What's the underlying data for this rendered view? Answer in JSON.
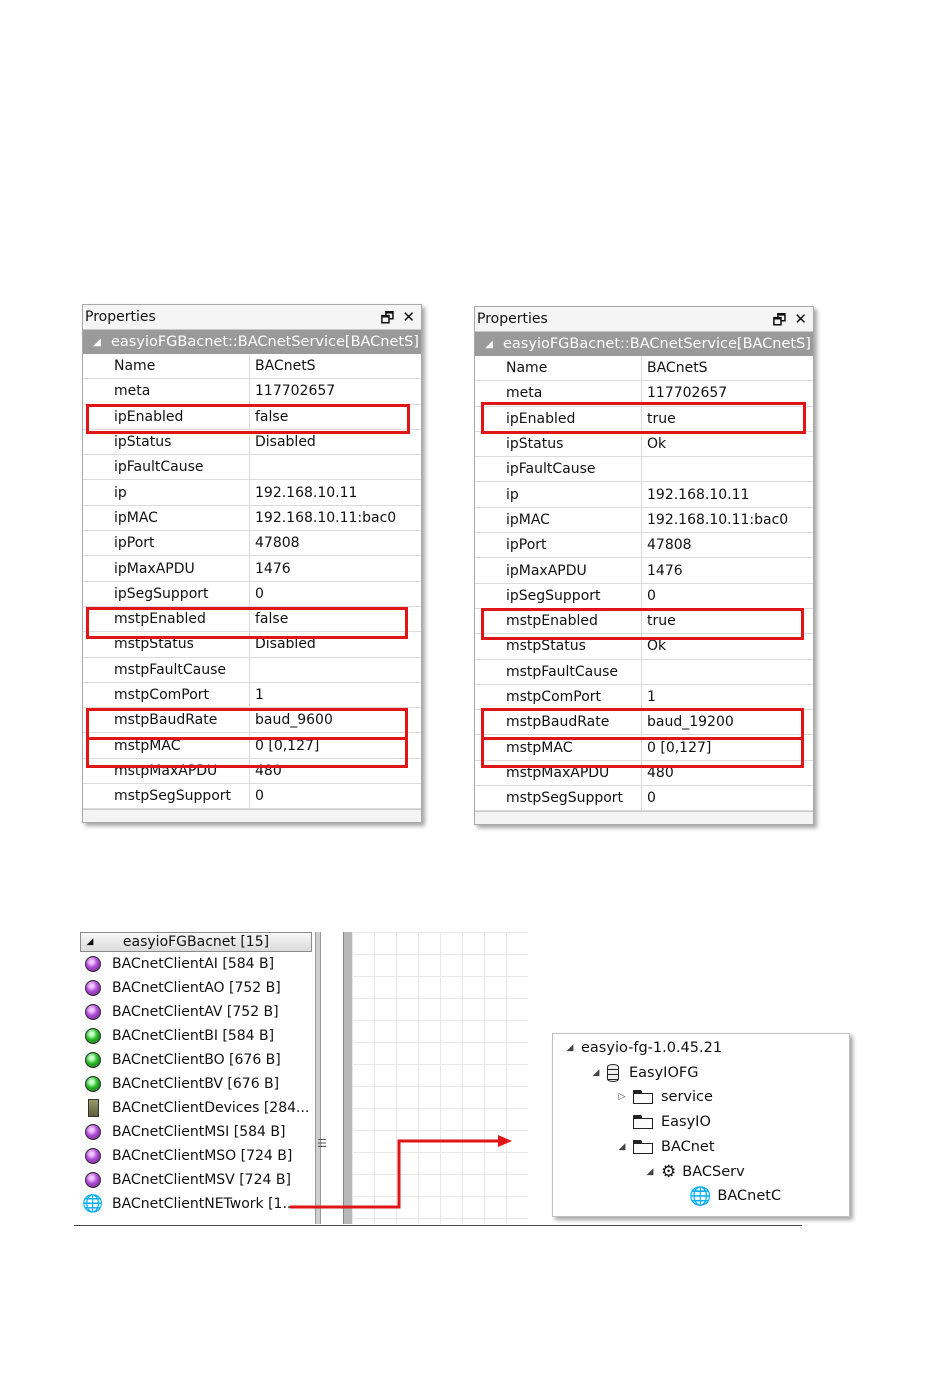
{
  "panel_left": {
    "title": "Properties",
    "object": "easyioFGBacnet::BACnetService[BACnetS]",
    "rows": [
      {
        "k": "Name",
        "v": "BACnetS"
      },
      {
        "k": "meta",
        "v": "117702657"
      },
      {
        "k": "ipEnabled",
        "v": "false"
      },
      {
        "k": "ipStatus",
        "v": "Disabled"
      },
      {
        "k": "ipFaultCause",
        "v": ""
      },
      {
        "k": "ip",
        "v": "192.168.10.11"
      },
      {
        "k": "ipMAC",
        "v": "192.168.10.11:bac0"
      },
      {
        "k": "ipPort",
        "v": "47808"
      },
      {
        "k": "ipMaxAPDU",
        "v": "1476"
      },
      {
        "k": "ipSegSupport",
        "v": "0"
      },
      {
        "k": "mstpEnabled",
        "v": "false"
      },
      {
        "k": "mstpStatus",
        "v": "Disabled"
      },
      {
        "k": "mstpFaultCause",
        "v": ""
      },
      {
        "k": "mstpComPort",
        "v": "1"
      },
      {
        "k": "mstpBaudRate",
        "v": "baud_9600"
      },
      {
        "k": "mstpMAC",
        "v": "0 [0,127]"
      },
      {
        "k": "mstpMaxAPDU",
        "v": "480"
      },
      {
        "k": "mstpSegSupport",
        "v": "0"
      }
    ]
  },
  "panel_right": {
    "title": "Properties",
    "object": "easyioFGBacnet::BACnetService[BACnetS]",
    "rows": [
      {
        "k": "Name",
        "v": "BACnetS"
      },
      {
        "k": "meta",
        "v": "117702657"
      },
      {
        "k": "ipEnabled",
        "v": "true"
      },
      {
        "k": "ipStatus",
        "v": "Ok"
      },
      {
        "k": "ipFaultCause",
        "v": ""
      },
      {
        "k": "ip",
        "v": "192.168.10.11"
      },
      {
        "k": "ipMAC",
        "v": "192.168.10.11:bac0"
      },
      {
        "k": "ipPort",
        "v": "47808"
      },
      {
        "k": "ipMaxAPDU",
        "v": "1476"
      },
      {
        "k": "ipSegSupport",
        "v": "0"
      },
      {
        "k": "mstpEnabled",
        "v": "true"
      },
      {
        "k": "mstpStatus",
        "v": "Ok"
      },
      {
        "k": "mstpFaultCause",
        "v": ""
      },
      {
        "k": "mstpComPort",
        "v": "1"
      },
      {
        "k": "mstpBaudRate",
        "v": "baud_19200"
      },
      {
        "k": "mstpMAC",
        "v": "0 [0,127]"
      },
      {
        "k": "mstpMaxAPDU",
        "v": "480"
      },
      {
        "k": "mstpSegSupport",
        "v": "0"
      }
    ]
  },
  "highlight_color": "#e01616",
  "palette": {
    "header": "easyioFGBacnet [15]",
    "items": [
      {
        "icon": "purple-ball-icon",
        "label": "BACnetClientAI [584 B]"
      },
      {
        "icon": "purple-ball-icon",
        "label": "BACnetClientAO [752 B]"
      },
      {
        "icon": "purple-ball-icon",
        "label": "BACnetClientAV [752 B]"
      },
      {
        "icon": "green-ball-icon",
        "label": "BACnetClientBI [584 B]"
      },
      {
        "icon": "green-ball-icon",
        "label": "BACnetClientBO [676 B]"
      },
      {
        "icon": "green-ball-icon",
        "label": "BACnetClientBV [676 B]"
      },
      {
        "icon": "devices-icon",
        "label": "BACnetClientDevices [284..."
      },
      {
        "icon": "purple-ball-icon",
        "label": "BACnetClientMSI [584 B]"
      },
      {
        "icon": "purple-ball-icon",
        "label": "BACnetClientMSO [724 B]"
      },
      {
        "icon": "purple-ball-icon",
        "label": "BACnetClientMSV [724 B]"
      },
      {
        "icon": "network-globe-icon",
        "label": "BACnetClientNETwork [1..."
      }
    ]
  },
  "tree": {
    "root": "easyio-fg-1.0.45.21",
    "app": "EasyIOFG",
    "service": "service",
    "easyio": "EasyIO",
    "bacnet": "BACnet",
    "bacserv": "BACServ",
    "bacnetc": "BACnetC"
  }
}
